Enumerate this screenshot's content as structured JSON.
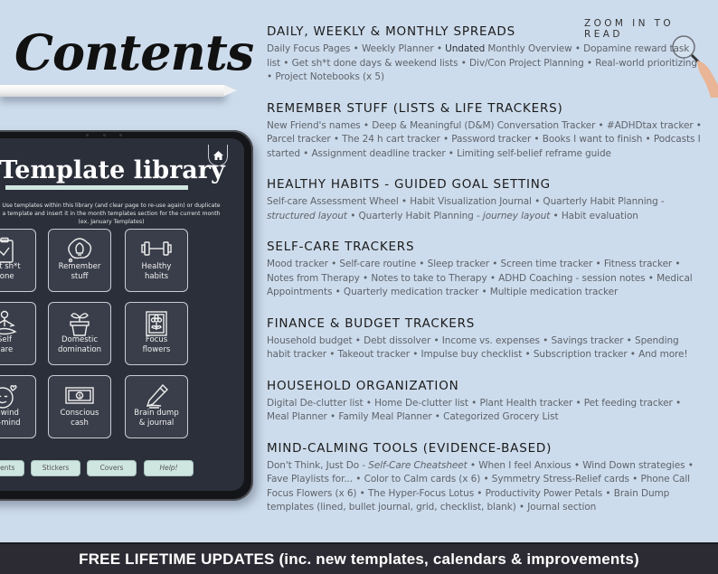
{
  "title": "Contents",
  "zoom_note": "ZOOM IN TO READ",
  "tablet": {
    "library_title": "Template library",
    "library_description": "Use templates within this library (and clear page to re-use again) or duplicate a template and insert it in the month templates section for the current month (ex. January Templates)",
    "home_icon": "home-icon",
    "tiles": [
      {
        "label_1": "Get sh*t",
        "label_2": "done",
        "icon": "clipboard-check-icon"
      },
      {
        "label_1": "Remember",
        "label_2": "stuff",
        "icon": "lightbulb-thought-icon"
      },
      {
        "label_1": "Healthy",
        "label_2": "habits",
        "icon": "dumbbell-icon"
      },
      {
        "label_1": "Self",
        "label_2": "care",
        "icon": "meditation-icon"
      },
      {
        "label_1": "Domestic",
        "label_2": "domination",
        "icon": "plant-pot-icon"
      },
      {
        "label_1": "Focus",
        "label_2": "flowers",
        "icon": "framed-flower-icon"
      },
      {
        "label_1": "Unwind",
        "label_2": "un-mind",
        "icon": "calm-face-heart-icon"
      },
      {
        "label_1": "Conscious",
        "label_2": "cash",
        "icon": "banknote-icon"
      },
      {
        "label_1": "Brain dump",
        "label_2": "& journal",
        "icon": "pencil-icon"
      }
    ],
    "nav_buttons": [
      "Contents",
      "Stickers",
      "Covers",
      "Help!"
    ]
  },
  "sections": [
    {
      "heading": "DAILY, WEEKLY & MONTHLY SPREADS",
      "body_pre": "Daily Focus Pages • Weekly Planner • ",
      "body_bold": "Undated",
      "body_post": " Monthly Overview • Dopamine reward task list • Get sh*t done days & weekend lists • Div/Con Project Planning • Real-world prioritizing • Project Notebooks (x 5)"
    },
    {
      "heading": "REMEMBER STUFF (LISTS & LIFE TRACKERS)",
      "body": "New Friend's names • Deep & Meaningful (D&M) Conversation Tracker • #ADHDtax tracker • Parcel tracker • The  24 h cart tracker • Password tracker • Books I want to finish • Podcasts I started • Assignment deadline tracker • Limiting self-belief reframe guide"
    },
    {
      "heading": "HEALTHY HABITS - GUIDED GOAL SETTING",
      "body_1": "Self-care Assessment Wheel • Habit Visualization Journal • Quarterly Habit Planning - ",
      "body_italic_1": "structured layout",
      "body_2": " • Quarterly Habit Planning - ",
      "body_italic_2": "journey layout",
      "body_3": " • Habit evaluation"
    },
    {
      "heading": "SELF-CARE TRACKERS",
      "body": "Mood tracker • Self-care routine • Sleep tracker • Screen time tracker • Fitness tracker • Notes from Therapy • Notes to take to Therapy •  ADHD Coaching - session notes • Medical Appointments • Quarterly medication tracker • Multiple medication tracker"
    },
    {
      "heading": "FINANCE & BUDGET TRACKERS",
      "body": "Household budget • Debt dissolver • Income vs. expenses • Savings tracker • Spending habit tracker • Takeout tracker • Impulse buy checklist • Subscription tracker • And more!"
    },
    {
      "heading": "HOUSEHOLD ORGANIZATION",
      "body": "Digital De-clutter list • Home De-clutter list • Plant Health tracker •  Pet feeding tracker • Meal Planner • Family Meal Planner • Categorized Grocery List"
    },
    {
      "heading": "MIND-CALMING TOOLS (EVIDENCE-BASED)",
      "body_1": "Don't Think, Just Do - ",
      "body_italic_1": "Self-Care Cheatsheet",
      "body_2": " • When I feel Anxious • Wind Down strategies • Fave Playlists for... • Color to Calm cards (x 6) • Symmetry Stress-Relief cards • Phone Call Focus Flowers (x 6) • The Hyper-Focus Lotus • Productivity Power Petals • Brain Dump templates (lined, bullet journal, grid, checklist, blank) • Journal section"
    }
  ],
  "footer": "FREE LIFETIME UPDATES (inc. new templates, calendars & improvements)",
  "colors": {
    "background": "#cddcec",
    "screen": "#2b2f3a",
    "accent_mint": "#cfe6e0",
    "footer_bg": "#2c2b34"
  }
}
